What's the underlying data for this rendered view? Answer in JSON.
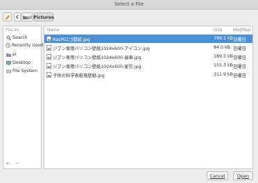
{
  "window": {
    "title": "Select a File"
  },
  "toolbar": {
    "edit_icon": "pencil-icon",
    "back_icon": "chevron-left-icon",
    "path": [
      {
        "label": "pi",
        "icon": "folder-icon"
      },
      {
        "label": "Pictures",
        "active": true
      }
    ]
  },
  "sidebar": {
    "header": "Places",
    "items": [
      {
        "label": "Search",
        "icon": "search-icon"
      },
      {
        "label": "Recently Used",
        "icon": "clock-icon"
      },
      {
        "label": "pi",
        "icon": "home-folder-icon"
      },
      {
        "label": "Desktop",
        "icon": "desktop-icon"
      },
      {
        "label": "File System",
        "icon": "drive-icon"
      }
    ],
    "add_label": "+",
    "remove_label": "−"
  },
  "file_list": {
    "columns": {
      "name": "Name",
      "size": "Size",
      "modified": "Modified"
    },
    "rows": [
      {
        "name": "RasPiロゴ壁紙.jpg",
        "size": "799.1 kB",
        "modified": "日曜日",
        "selected": true
      },
      {
        "name": "ジブン専用パソコン壁紙1024x600-アイコン.jpg",
        "size": "84.0 kB",
        "modified": "日曜日"
      },
      {
        "name": "ジブン専用パソコン壁紙1024x600-歯車.jpg",
        "size": "189.5 kB",
        "modified": "日曜日"
      },
      {
        "name": "ジブン専用パソコン壁紙1024x600-星空.jpg",
        "size": "155.3 kB",
        "modified": "日曜日"
      },
      {
        "name": "子供の科学表紙風壁紙.jpg",
        "size": "311.9 kB",
        "modified": "日曜日"
      }
    ]
  },
  "actions": {
    "cancel_label": "Cancel",
    "open_label": "Open"
  },
  "colors": {
    "selection": "#4a90d9",
    "window_bg": "#ededed"
  }
}
